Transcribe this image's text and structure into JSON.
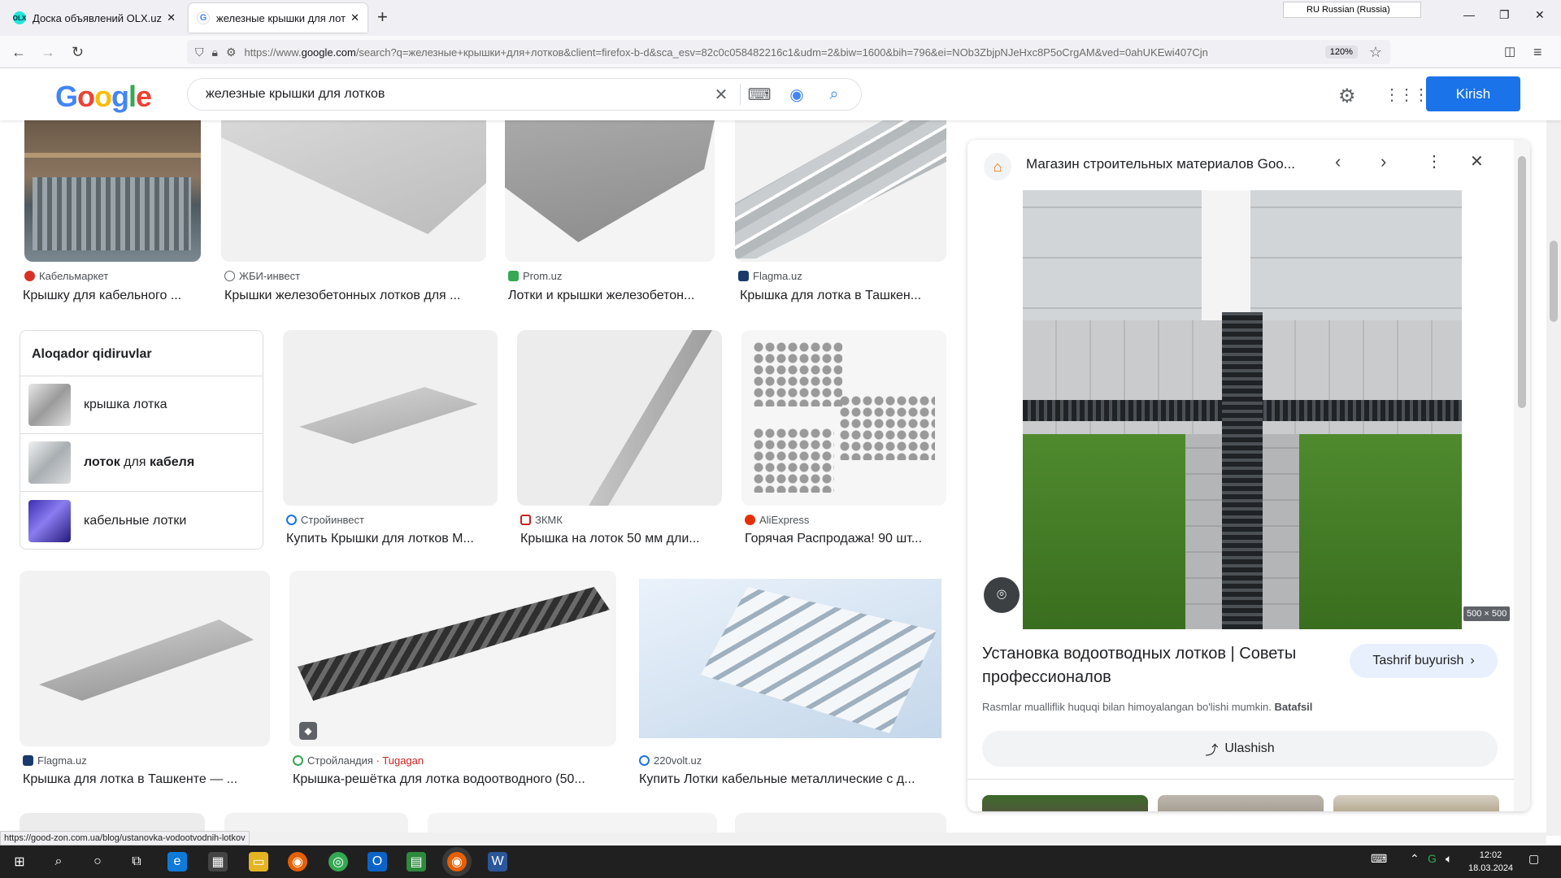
{
  "browser": {
    "tabs": [
      {
        "title": "Доска объявлений OLX.uz, ра",
        "favicon": "olx-icon"
      },
      {
        "title": "железные крышки для лотков",
        "favicon": "google-icon"
      }
    ],
    "language": "RU Russian (Russia)",
    "url_prefix": "https://www.",
    "url_domain": "google.com",
    "url_rest": "/search?q=железные+крышки+для+лотков&client=firefox-b-d&sca_esv=82c0c058482216c1&udm=2&biw=1600&bih=796&ei=NOb3ZbjpNJeHxc8P5oCrgAM&ved=0ahUKEwi407Cjn",
    "zoom": "120%",
    "status_url": "https://good-zon.com.ua/blog/ustanovka-vodootvodnih-lotkov"
  },
  "google": {
    "logo": "Google",
    "query": "железные крышки для лотков",
    "signin_label": "Kirish"
  },
  "results_row1": [
    {
      "source": "Кабельмаркет",
      "title": "Крышку для кабельного ...",
      "color": "#d93025"
    },
    {
      "source": "ЖБИ-инвест",
      "title": "Крышки железобетонных лотков для ...",
      "color": "#5f6368"
    },
    {
      "source": "Prom.uz",
      "title": "Лотки и крышки железобетон...",
      "color": "#34a853"
    },
    {
      "source": "Flagma.uz",
      "title": "Крышка для лотка в Ташкен...",
      "color": "#1a3a6b"
    }
  ],
  "related": {
    "heading": "Aloqador qidiruvlar",
    "items": [
      {
        "plain": "крышка лотка",
        "bold1": "",
        "mid": "",
        "bold2": ""
      },
      {
        "plain": "",
        "bold1": "лоток",
        "mid": " для ",
        "bold2": "кабеля"
      },
      {
        "plain": "кабельные лотки",
        "bold1": "",
        "mid": "",
        "bold2": ""
      }
    ]
  },
  "results_row2": [
    {
      "source": "Стройинвест",
      "title": "Купить Крышки для лотков М...",
      "color": "#1a73e8"
    },
    {
      "source": "ЗКМК",
      "title": "Крышка на лоток 50 мм дли...",
      "color": "#c5221f"
    },
    {
      "source": "AliExpress",
      "title": "Горячая Распродажа! 90 шт...",
      "color": "#e62e04"
    }
  ],
  "results_row3": [
    {
      "source": "Flagma.uz",
      "extra": "",
      "title": "Крышка для лотка в Ташкенте — ...",
      "color": "#1a3a6b"
    },
    {
      "source": "Стройландия",
      "extra": " · Tugagan",
      "title": "Крышка-решётка для лотка водоотводного (50...",
      "color": "#34a853"
    },
    {
      "source": "220volt.uz",
      "extra": "",
      "title": "Купить Лотки кабельные металлические с д...",
      "color": "#1a73e8"
    }
  ],
  "panel": {
    "site": "Магазин строительных материалов Goo...",
    "dimensions": "500 × 500",
    "title": "Установка водоотводных лотков | Советы профессионалов",
    "visit_label": "Tashrif buyurish",
    "copyright": "Rasmlar mualliflik huquqi bilan himoyalangan bo'lishi mumkin.",
    "details": "Batafsil",
    "share_label": "Ulashish"
  },
  "taskbar": {
    "time": "12:02",
    "date": "18.03.2024"
  }
}
